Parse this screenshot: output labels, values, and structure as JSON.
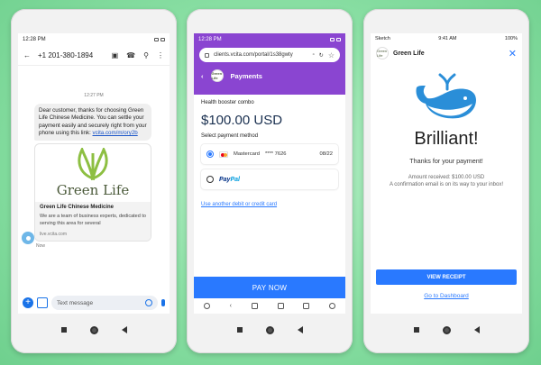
{
  "phone1": {
    "status_time": "12:28 PM",
    "phone_number": "+1 201-380-1894",
    "message_time": "12:27 PM",
    "message_text": "Dear customer, thanks for choosing Green Life Chinese Medicine. You can settle your payment easily and securely right from your phone using this link: ",
    "message_link": "vcita.com/m/ory2b",
    "brand_name": "Green Life",
    "card_title": "Green Life Chinese Medicine",
    "card_desc": "We are a team of business experts, dedicated to serving this area for several",
    "card_link": "live.vcita.com",
    "sent_label": "Now",
    "compose_placeholder": "Text message"
  },
  "phone2": {
    "status_time": "12:28 PM",
    "url": "clients.vcita.com/portal/1s38gwty",
    "header_title": "Payments",
    "logo_text": "Green Life",
    "item_name": "Health booster combo",
    "amount": "$100.00 USD",
    "select_label": "Select payment method",
    "card_brand": "Mastercard",
    "card_masked": "**** 7626",
    "card_expiry": "08/22",
    "paypal_pay": "Pay",
    "paypal_pal": "Pal",
    "another_card_link": "Use another debit or credit card",
    "pay_button": "PAY NOW"
  },
  "phone3": {
    "carrier": "Sketch",
    "status_time": "9:41 AM",
    "battery": "100%",
    "business_name": "Green Life",
    "logo_text": "Green Life",
    "headline": "Brilliant!",
    "thanks": "Thanks for your payment!",
    "received": "Amount received: $100.00 USD",
    "confirmation": "A confirmation email is on its way to your inbox!",
    "receipt_button": "VIEW RECEIPT",
    "dashboard_link": "Go to Dashboard"
  },
  "colors": {
    "accent_blue": "#2979ff",
    "header_purple": "#8a45d1",
    "brand_green": "#8dbf42",
    "whale_blue": "#2a8ed8"
  }
}
